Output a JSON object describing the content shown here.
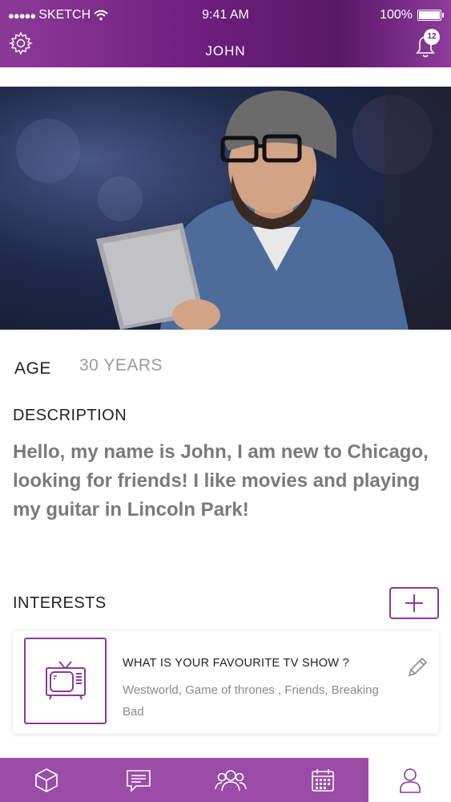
{
  "status_bar": {
    "carrier": "SKETCH",
    "time": "9:41 AM",
    "battery": "100%",
    "battery_level": 1.0
  },
  "header": {
    "title": "JOHN",
    "notification_count": "12"
  },
  "colors": {
    "brand": "#8c3a97",
    "header_dark": "#5a1767",
    "tabbar": "#9a4ca6"
  },
  "carousel": {
    "page_count": 4,
    "active_index": 0
  },
  "profile": {
    "age_label": "AGE",
    "age_value": "30 YEARS",
    "description_label": "DESCRIPTION",
    "description_text": "Hello, my name is John, I am new to Chicago, looking for friends! I like movies and playing my guitar in Lincoln Park!"
  },
  "interests": {
    "label": "INTERESTS",
    "items": [
      {
        "icon": "tv-icon",
        "question": "WHAT IS YOUR FAVOURITE TV SHOW ?",
        "answer": "Westworld, Game of thrones , Friends, Breaking Bad"
      }
    ]
  },
  "tabs": [
    {
      "icon": "cube-icon"
    },
    {
      "icon": "chat-icon"
    },
    {
      "icon": "group-icon"
    },
    {
      "icon": "calendar-icon"
    },
    {
      "icon": "profile-icon",
      "active": true
    }
  ]
}
